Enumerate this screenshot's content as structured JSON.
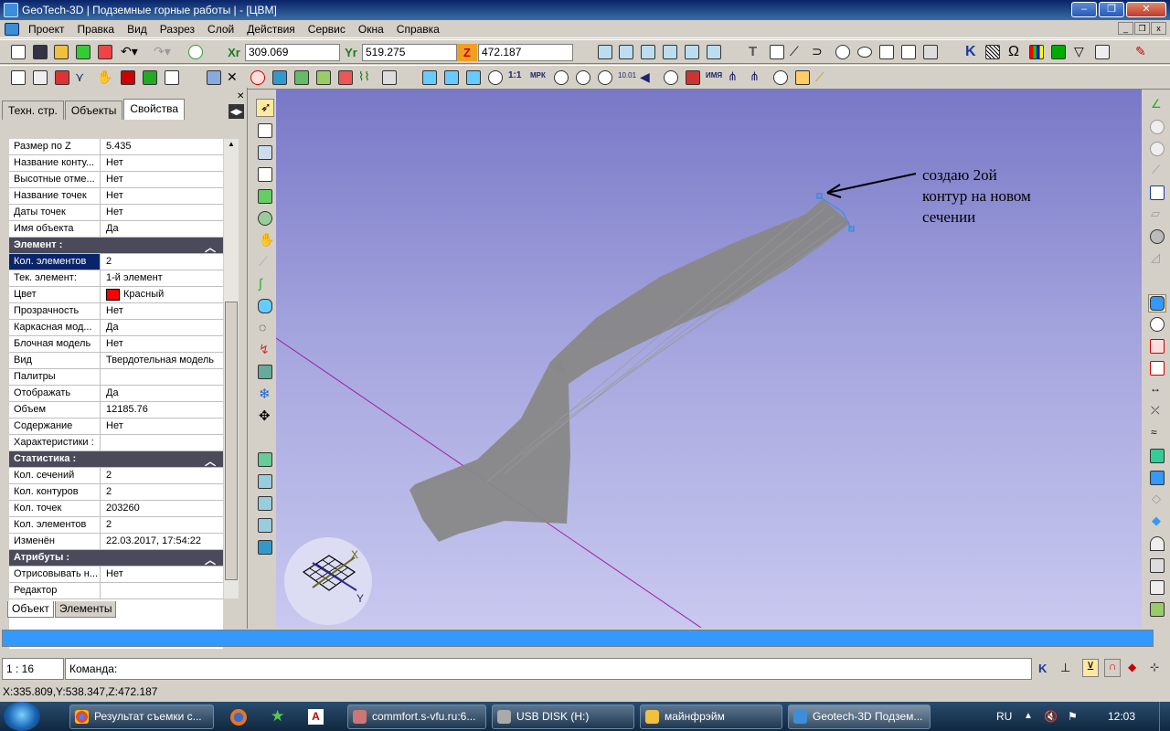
{
  "window": {
    "title": "GeoTech-3D | Подземные горные работы | - [ЦВМ]"
  },
  "menu": [
    "Проект",
    "Правка",
    "Вид",
    "Разрез",
    "Слой",
    "Действия",
    "Сервис",
    "Окна",
    "Справка"
  ],
  "coords": {
    "x_label": "Xr",
    "x": "309.069",
    "y_label": "Yr",
    "y": "519.275",
    "z_label": "Z",
    "z": "472.187"
  },
  "panel": {
    "tabs": [
      "Техн. стр.",
      "Объекты",
      "Свойства"
    ],
    "active_tab": 2,
    "rows": [
      {
        "k": "Размер по Z",
        "v": "5.435"
      },
      {
        "k": "Название конту...",
        "v": "Нет"
      },
      {
        "k": "Высотные отме...",
        "v": "Нет"
      },
      {
        "k": "Название точек",
        "v": "Нет"
      },
      {
        "k": "Даты точек",
        "v": "Нет"
      },
      {
        "k": "Имя объекта",
        "v": "Да"
      },
      {
        "section": "Элемент :"
      },
      {
        "k": "Кол. элементов",
        "v": "2",
        "selected": true
      },
      {
        "k": "Тек. элемент:",
        "v": "1-й элемент"
      },
      {
        "k": "Цвет",
        "v": "Красный",
        "color": "#ff0000"
      },
      {
        "k": "Прозрачность",
        "v": "Нет"
      },
      {
        "k": "Каркасная мод...",
        "v": "Да"
      },
      {
        "k": "Блочная модель",
        "v": "Нет"
      },
      {
        "k": "Вид",
        "v": "Твердотельная модель"
      },
      {
        "k": "Палитры",
        "v": ""
      },
      {
        "k": "Отображать",
        "v": "Да"
      },
      {
        "k": "Объем",
        "v": "12185.76"
      },
      {
        "k": "Содержание",
        "v": "Нет"
      },
      {
        "k": "Характеристики :",
        "v": ""
      },
      {
        "section": "Статистика :"
      },
      {
        "k": "Кол. сечений",
        "v": "2"
      },
      {
        "k": "Кол. контуров",
        "v": "2"
      },
      {
        "k": "Кол. точек",
        "v": "203260"
      },
      {
        "k": "Кол. элементов",
        "v": "2"
      },
      {
        "k": "Изменён",
        "v": "22.03.2017, 17:54:22"
      },
      {
        "section": "Атрибуты :"
      },
      {
        "k": "Отрисовывать н...",
        "v": "Нет"
      },
      {
        "k": "Редактор",
        "v": ""
      }
    ],
    "bottom_tabs": [
      "Объект",
      "Элементы"
    ]
  },
  "viewport": {
    "annotation": [
      "создаю 2ой",
      "контур на новом",
      "сечении"
    ],
    "axis_x": "X",
    "axis_y": "Y",
    "model_color": "#888888",
    "axis_line_color": "#a020a0"
  },
  "status": {
    "scale": "1 : 16",
    "command_label": "Команда:",
    "coords": "X:335.809,Y:538.347,Z:472.187",
    "progress_color": "#3399ff",
    "snap_label": "K"
  },
  "taskbar": {
    "items": [
      {
        "label": "Результат съемки с...",
        "icon": "chrome-icon"
      },
      {
        "label": "commfort.s-vfu.ru:6...",
        "icon": "commfort-icon"
      },
      {
        "label": "USB DISK (H:)",
        "icon": "drive-icon"
      },
      {
        "label": "майнфрэйм",
        "icon": "folder-icon"
      },
      {
        "label": "Geotech-3D Подзем...",
        "icon": "geotech-icon",
        "active": true
      }
    ],
    "lang": "RU",
    "time": "12:03"
  }
}
